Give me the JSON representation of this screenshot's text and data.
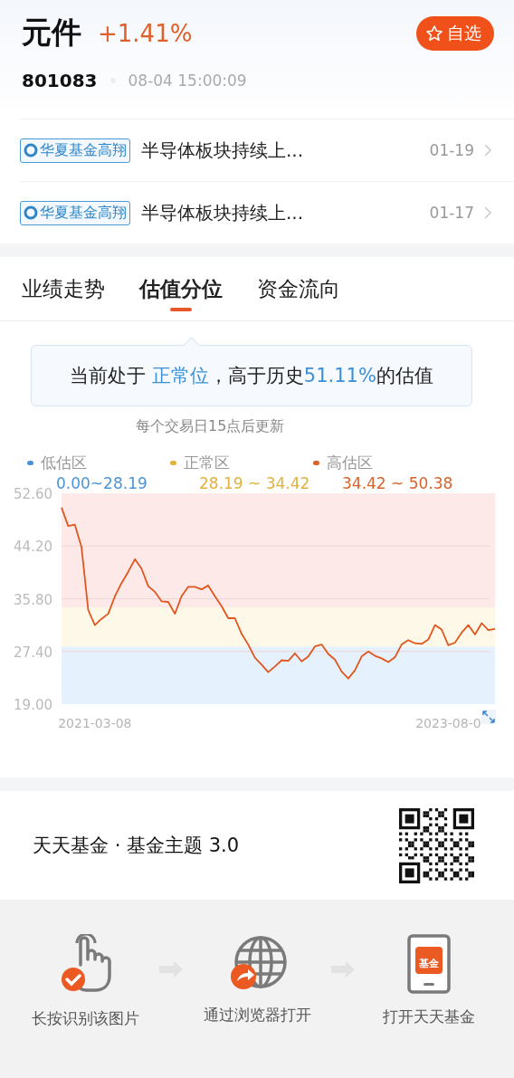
{
  "header": {
    "title": "元件",
    "change": "+1.41%",
    "watch_button": "自选",
    "code": "801083",
    "timestamp": "08-04 15:00:09"
  },
  "news": [
    {
      "tag": "华夏基金高翔",
      "title": "半导体板块持续上...",
      "date": "01-19"
    },
    {
      "tag": "华夏基金高翔",
      "title": "半导体板块持续上...",
      "date": "01-17"
    }
  ],
  "tabs": [
    {
      "label": "业绩走势",
      "selected": false
    },
    {
      "label": "估值分位",
      "selected": true
    },
    {
      "label": "资金流向",
      "selected": false
    }
  ],
  "valuation": {
    "summary": [
      {
        "text": "当前处于 ",
        "highlight": false
      },
      {
        "text": "正常位",
        "highlight": true
      },
      {
        "text": "，高于历史",
        "highlight": false
      },
      {
        "text": "51.11%",
        "highlight": true
      },
      {
        "text": "的估值",
        "highlight": false
      }
    ],
    "note": "每个交易日15点后更新",
    "zones": [
      {
        "label": "低估区",
        "range": "0.00~28.19",
        "color": "#4a94d6"
      },
      {
        "label": "正常区",
        "range": "28.19 ~ 34.42",
        "color": "#e2b13c"
      },
      {
        "label": "高估区",
        "range": "34.42 ~ 50.38",
        "color": "#d9622b"
      }
    ],
    "chart_data": {
      "type": "line",
      "ylim": [
        19,
        52.6
      ],
      "grid": true,
      "yticks": [
        {
          "value": 19,
          "label": "19.00"
        },
        {
          "value": 27.4,
          "label": "27.40"
        },
        {
          "value": 35.8,
          "label": "35.80"
        },
        {
          "value": 44.2,
          "label": "44.20"
        },
        {
          "value": 52.6,
          "label": "52.60"
        }
      ],
      "categories": [
        null,
        null,
        null,
        null,
        null,
        "2021-03-08",
        null,
        null,
        null,
        null,
        null,
        null,
        null,
        null,
        null,
        null,
        null,
        null,
        null,
        null,
        null,
        null,
        null,
        null,
        null,
        null,
        null,
        null,
        null,
        null,
        null,
        null,
        null,
        null,
        null,
        null,
        null,
        null,
        null,
        null,
        null,
        null,
        null,
        null,
        null,
        null,
        null,
        null,
        null,
        null,
        null,
        null,
        null,
        null,
        null,
        null,
        null,
        null,
        "2023-08-0",
        null,
        null,
        null,
        null,
        null,
        null,
        null
      ],
      "bands": [
        {
          "axis": "y",
          "from": 19,
          "to": 28.19,
          "color": "#e5f1fc"
        },
        {
          "axis": "y",
          "from": 28.19,
          "to": 34.42,
          "color": "#fdf8e7"
        },
        {
          "axis": "y",
          "from": 34.42,
          "to": 52.6,
          "color": "#fde9e8"
        }
      ],
      "series": [
        {
          "color": "#e0561f",
          "values": [
            50.3,
            47.4,
            47.6,
            44,
            34,
            31.6,
            32.6,
            33.4,
            36.2,
            38.3,
            40.1,
            42.1,
            40.6,
            37.8,
            36.9,
            35.4,
            35.3,
            33.4,
            36.2,
            37.7,
            37.7,
            37.3,
            37.9,
            36.2,
            34.6,
            32.7,
            32.7,
            30.2,
            28.5,
            26.4,
            25.3,
            24.1,
            25,
            26,
            25.9,
            27.1,
            25.8,
            26.6,
            28.2,
            28.5,
            27,
            26.1,
            24.2,
            23.1,
            24.4,
            26.6,
            27.4,
            26.7,
            26.3,
            25.7,
            26.5,
            28.5,
            29.2,
            28.7,
            28.6,
            29.3,
            31.6,
            30.9,
            28.4,
            28.8,
            30.4,
            31.6,
            30.1,
            31.9,
            30.8,
            31
          ]
        }
      ]
    }
  },
  "footer": {
    "title": "天天基金 · 基金主题 3.0",
    "steps": [
      {
        "kind": "hand",
        "label": "长按识别该图片"
      },
      {
        "kind": "globe",
        "label": "通过浏览器打开"
      },
      {
        "kind": "phone",
        "label": "打开天天基金",
        "icon_text": "基金"
      }
    ]
  }
}
